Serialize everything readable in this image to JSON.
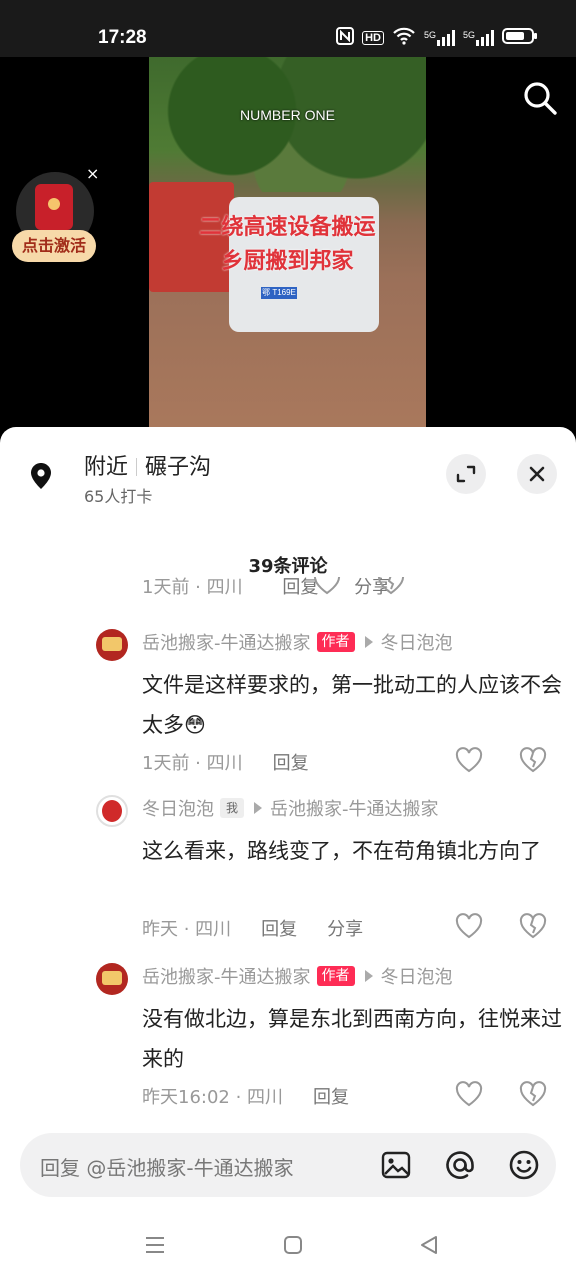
{
  "status_bar": {
    "time": "17:28",
    "net1": "5G",
    "net2": "5G",
    "hd": "HD"
  },
  "video": {
    "caption_top": "NUMBER ONE",
    "caption_line1": "二绕高速设备搬运",
    "caption_line2": "乡厨搬到邦家",
    "plate": "鄂 T169E"
  },
  "red_packet": {
    "label": "点击激活",
    "close": "×"
  },
  "location": {
    "prefix": "附近",
    "name": "碾子沟",
    "checkins": "65人打卡"
  },
  "comments_header": "39条评论",
  "partial_row": {
    "meta": "1天前 · 四川",
    "reply": "回复",
    "share": "分享"
  },
  "comments": [
    {
      "user": "岳池搬家-牛通达搬家",
      "tag": "作者",
      "reply_to": "冬日泡泡",
      "text": "文件是这样要求的，第一批动工的人应该不会太多😳",
      "meta": "1天前 · 四川",
      "reply": "回复"
    },
    {
      "user": "冬日泡泡",
      "tag": "我",
      "reply_to": "岳池搬家-牛通达搬家",
      "text": "这么看来，路线变了，不在苟角镇北方向了",
      "meta": "昨天 · 四川",
      "reply": "回复",
      "share": "分享"
    },
    {
      "user": "岳池搬家-牛通达搬家",
      "tag": "作者",
      "reply_to": "冬日泡泡",
      "text": "没有做北边，算是东北到西南方向，往悦来过来的",
      "meta": "昨天16:02 · 四川",
      "reply": "回复"
    }
  ],
  "input": {
    "placeholder": "回复 @岳池搬家-牛通达搬家"
  },
  "icons": {
    "search": "search-icon",
    "location": "location-pin-icon",
    "collapse": "collapse-icon",
    "close": "close-icon",
    "like": "heart-icon",
    "dislike": "broken-heart-icon",
    "image": "image-icon",
    "mention": "at-icon",
    "emoji": "emoji-icon"
  },
  "colors": {
    "author_tag": "#fe2c55",
    "sheet_bg": "#ffffff"
  }
}
